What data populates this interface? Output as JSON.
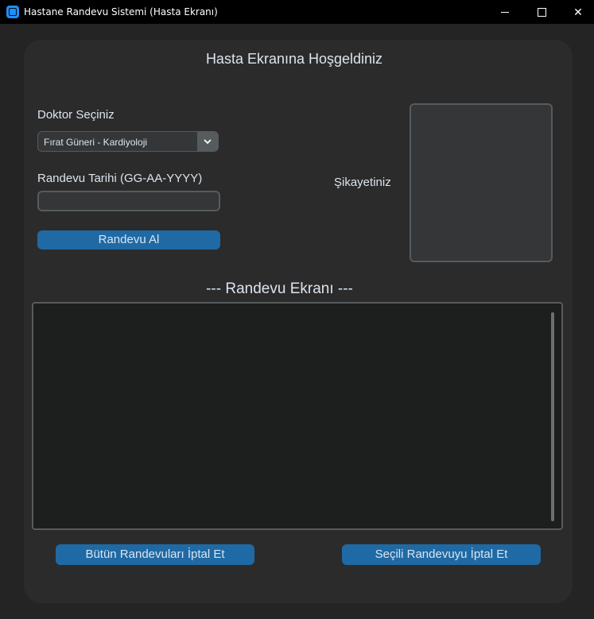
{
  "window": {
    "title": "Hastane Randevu Sistemi (Hasta Ekranı)"
  },
  "main": {
    "heading": "Hasta Ekranına Hoşgeldiniz",
    "doctor_label": "Doktor Seçiniz",
    "doctor_selected": "Fırat Güneri - Kardiyoloji",
    "date_label": "Randevu Tarihi (GG-AA-YYYY)",
    "date_value": "",
    "book_button": "Randevu Al",
    "complaint_label": "Şikayetiniz",
    "complaint_value": ""
  },
  "appointments": {
    "title": "--- Randevu Ekranı ---",
    "items": [],
    "cancel_all_button": "Bütün Randevuları İptal Et",
    "cancel_selected_button": "Seçili Randevuyu İptal Et"
  },
  "colors": {
    "accent": "#1f6aa5",
    "background": "#242424",
    "panel": "#2b2b2b"
  },
  "icons": [
    "app-icon",
    "minimize-icon",
    "maximize-icon",
    "close-icon",
    "chevron-down-icon"
  ]
}
